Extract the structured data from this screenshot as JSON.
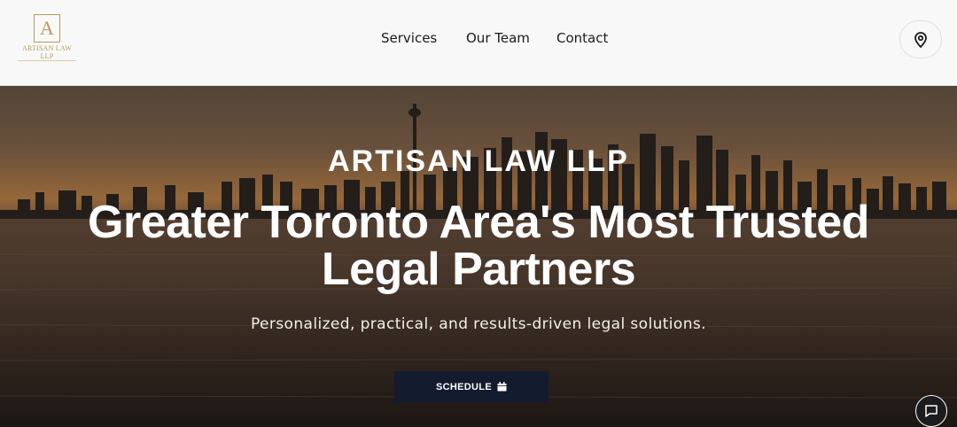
{
  "header": {
    "logo": {
      "monogram": "A",
      "name_line1": "ARTISAN LAW",
      "name_line2": "LLP"
    },
    "nav": [
      {
        "label": "Services"
      },
      {
        "label": "Our Team"
      },
      {
        "label": "Contact"
      }
    ],
    "location_button_icon": "map-pin-icon"
  },
  "hero": {
    "eyebrow": "ARTISAN LAW LLP",
    "headline_line1": "Greater Toronto Area's Most Trusted",
    "headline_line2": "Legal Partners",
    "subhead": "Personalized, practical, and results-driven legal solutions.",
    "cta_label": "SCHEDULE",
    "cta_icon": "calendar-icon"
  },
  "chat_widget_icon": "chat-bubble-icon",
  "colors": {
    "brand_gold": "#b89a5e",
    "cta_navy": "#131b2e",
    "header_bg": "#f8f8f8"
  }
}
